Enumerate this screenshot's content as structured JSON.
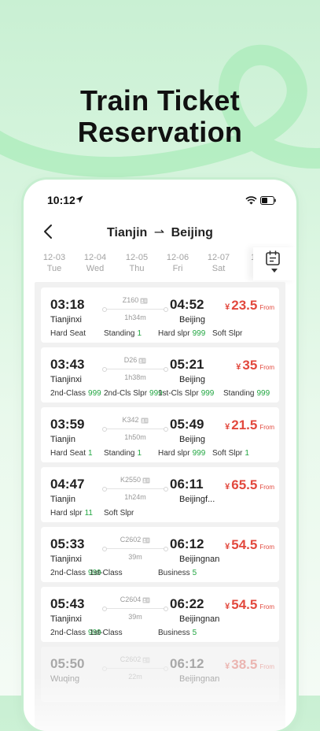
{
  "headline": {
    "line1": "Train Ticket",
    "line2": "Reservation"
  },
  "status": {
    "time": "10:12"
  },
  "nav": {
    "from": "Tianjin",
    "to": "Beijing",
    "arrow": "⇀"
  },
  "dates": [
    {
      "date": "12-03",
      "day": "Tue"
    },
    {
      "date": "12-04",
      "day": "Wed"
    },
    {
      "date": "12-05",
      "day": "Thu"
    },
    {
      "date": "12-06",
      "day": "Fri"
    },
    {
      "date": "12-07",
      "day": "Sat"
    },
    {
      "date": "1",
      "day": ""
    }
  ],
  "trains": [
    {
      "dep_time": "03:18",
      "dep_station": "Tianjinxi",
      "train_no": "Z160",
      "duration": "1h34m",
      "arr_time": "04:52",
      "arr_station": "Beijing",
      "currency": "¥",
      "price": "23.5",
      "from_label": "From",
      "seats": [
        {
          "type": "Hard Seat",
          "count": ""
        },
        {
          "type": "Standing",
          "count": "1"
        },
        {
          "type": "Hard slpr",
          "count": "999"
        },
        {
          "type": "Soft Slpr",
          "count": ""
        }
      ]
    },
    {
      "dep_time": "03:43",
      "dep_station": "Tianjinxi",
      "train_no": "D26",
      "duration": "1h38m",
      "arr_time": "05:21",
      "arr_station": "Beijing",
      "currency": "¥",
      "price": "35",
      "from_label": "From",
      "seats": [
        {
          "type": "2nd-Class",
          "count": "999"
        },
        {
          "type": "2nd-Cls Slpr",
          "count": "999"
        },
        {
          "type": "1st-Cls Slpr",
          "count": "999"
        },
        {
          "type": "Standing",
          "count": "999"
        }
      ]
    },
    {
      "dep_time": "03:59",
      "dep_station": "Tianjin",
      "train_no": "K342",
      "duration": "1h50m",
      "arr_time": "05:49",
      "arr_station": "Beijing",
      "currency": "¥",
      "price": "21.5",
      "from_label": "From",
      "seats": [
        {
          "type": "Hard Seat",
          "count": "1"
        },
        {
          "type": "Standing",
          "count": "1"
        },
        {
          "type": "Hard slpr",
          "count": "999"
        },
        {
          "type": "Soft Slpr",
          "count": "1"
        }
      ]
    },
    {
      "dep_time": "04:47",
      "dep_station": "Tianjin",
      "train_no": "K2550",
      "duration": "1h24m",
      "arr_time": "06:11",
      "arr_station": "Beijingf...",
      "currency": "¥",
      "price": "65.5",
      "from_label": "From",
      "seats": [
        {
          "type": "Hard slpr",
          "count": "11"
        },
        {
          "type": "Soft Slpr",
          "count": ""
        }
      ]
    },
    {
      "dep_time": "05:33",
      "dep_station": "Tianjinxi",
      "train_no": "C2602",
      "duration": "39m",
      "arr_time": "06:12",
      "arr_station": "Beijingnan",
      "currency": "¥",
      "price": "54.5",
      "from_label": "From",
      "seats": [
        {
          "type": "2nd-Class",
          "count": "999"
        },
        {
          "type": "1st-Class",
          "count": ""
        },
        {
          "type": "Business",
          "count": "5"
        }
      ]
    },
    {
      "dep_time": "05:43",
      "dep_station": "Tianjinxi",
      "train_no": "C2604",
      "duration": "39m",
      "arr_time": "06:22",
      "arr_station": "Beijingnan",
      "currency": "¥",
      "price": "54.5",
      "from_label": "From",
      "seats": [
        {
          "type": "2nd-Class",
          "count": "999"
        },
        {
          "type": "1st-Class",
          "count": ""
        },
        {
          "type": "Business",
          "count": "5"
        }
      ]
    },
    {
      "dep_time": "05:50",
      "dep_station": "Wuqing",
      "train_no": "C2602",
      "duration": "22m",
      "arr_time": "06:12",
      "arr_station": "Beijingnan",
      "currency": "¥",
      "price": "38.5",
      "from_label": "From",
      "seats": []
    }
  ],
  "colors": {
    "price": "#e2483d",
    "count": "#22a642",
    "accent_green": "#9be8ad"
  },
  "icons": {
    "back": "chevron-left-icon",
    "calendar": "calendar-icon",
    "location": "location-arrow-icon",
    "wifi": "wifi-icon",
    "battery": "battery-icon",
    "id": "id-card-icon"
  }
}
